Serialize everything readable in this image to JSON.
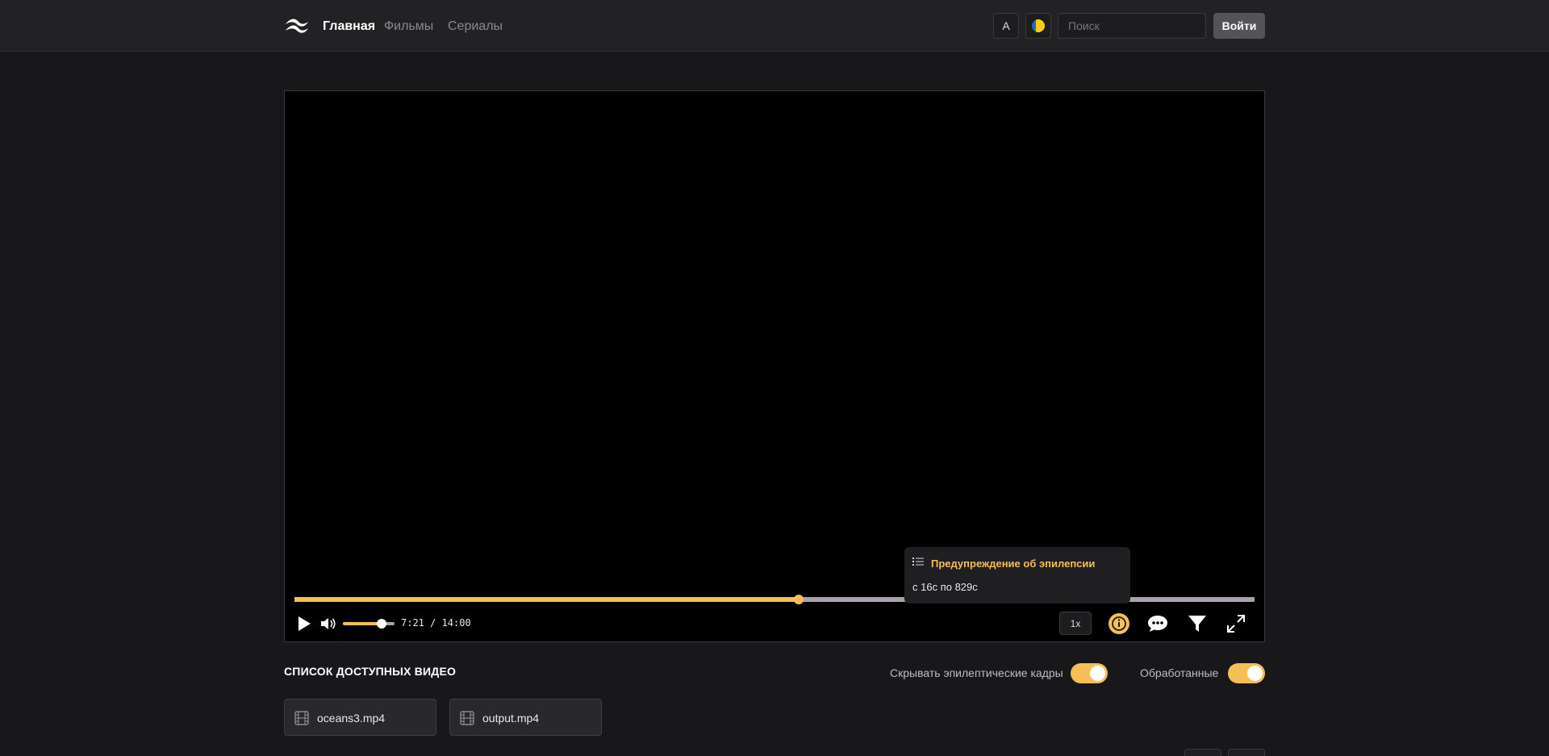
{
  "header": {
    "logo_icon": "tailwind-wave-logo",
    "nav": [
      {
        "label": "Главная",
        "active": true
      },
      {
        "label": "Фильмы",
        "active": false
      },
      {
        "label": "Сериалы",
        "active": false
      }
    ],
    "font_button_label": "A",
    "lang_icon": "ukraine-flag-icon",
    "search_placeholder": "Поиск",
    "login_label": "Войти"
  },
  "player": {
    "progress_fraction": 0.525,
    "volume_fraction": 0.75,
    "time_label": "7:21 / 14:00",
    "speed_label": "1x",
    "tooltip": {
      "icon": "list-icon",
      "title": "Предупреждение об эпилепсии",
      "range": "с 16с по 829с"
    },
    "icons": [
      "play-icon",
      "volume-icon",
      "info-icon",
      "chat-icon",
      "filter-icon",
      "fullscreen-icon"
    ]
  },
  "list": {
    "title": "СПИСОК ДОСТУПНЫХ ВИДЕО",
    "toggles": [
      {
        "label": "Скрывать эпилептические кадры",
        "on": true
      },
      {
        "label": "Обработанные",
        "on": true
      }
    ],
    "videos": [
      {
        "name": "oceans3.mp4",
        "icon": "film-icon"
      },
      {
        "name": "output.mp4",
        "icon": "film-icon"
      }
    ]
  },
  "colors": {
    "accent": "#f4bf55",
    "background": "#18171a",
    "header": "#222124"
  }
}
